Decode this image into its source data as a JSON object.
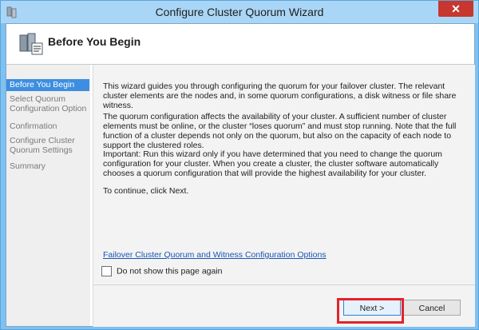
{
  "window": {
    "title": "Configure Cluster Quorum Wizard",
    "close_glyph": "✕"
  },
  "header": {
    "title": "Before You Begin"
  },
  "sidebar": {
    "items": [
      {
        "label": "Before You Begin"
      },
      {
        "label": "Select Quorum Configuration Option"
      },
      {
        "label": "Confirmation"
      },
      {
        "label": "Configure Cluster Quorum Settings"
      },
      {
        "label": "Summary"
      }
    ]
  },
  "main": {
    "paragraphs": [
      "This wizard guides you through configuring the quorum for your failover cluster. The relevant cluster elements are the nodes and, in some quorum configurations, a disk witness or file share witness.",
      "The quorum configuration affects the availability of your cluster. A sufficient number of cluster elements must be online, or the cluster “loses quorum” and must stop running. Note that the full function of a cluster depends not only on the quorum, but also on the capacity of each node to support the clustered roles.",
      "Important: Run this wizard only if you have determined that you need to change the quorum configuration for your cluster. When you create a cluster, the cluster software automatically chooses a quorum configuration that will provide the highest availability for your cluster.",
      "To continue, click Next."
    ],
    "link": "Failover Cluster Quorum and Witness Configuration Options",
    "checkbox_label": "Do not show this page again"
  },
  "footer": {
    "next_label": "Next >",
    "cancel_label": "Cancel"
  }
}
